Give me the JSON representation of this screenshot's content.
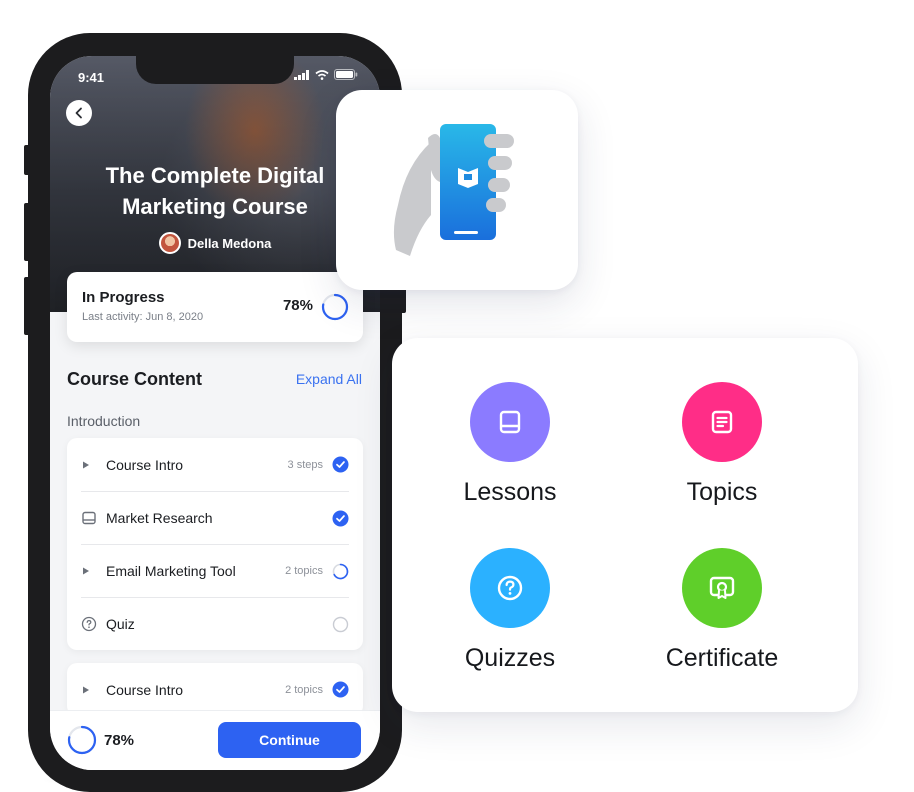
{
  "phone": {
    "status_time": "9:41",
    "course_title_line1": "The Complete Digital",
    "course_title_line2": "Marketing Course",
    "author_name": "Della Medona",
    "progress": {
      "title": "In Progress",
      "last_activity": "Last activity: Jun 8, 2020",
      "percent_label": "78%",
      "percent": 78
    },
    "section_title": "Course Content",
    "expand_all_label": "Expand All",
    "group_label": "Introduction",
    "lessons": [
      {
        "label": "Course Intro",
        "lead_icon": "triangle-right-icon",
        "meta": "3 steps",
        "status": "complete"
      },
      {
        "label": "Market Research",
        "lead_icon": "book-icon",
        "meta": "",
        "status": "complete"
      },
      {
        "label": "Email Marketing Tool",
        "lead_icon": "triangle-right-icon",
        "meta": "2 topics",
        "status": "partial"
      },
      {
        "label": "Quiz",
        "lead_icon": "question-icon",
        "meta": "",
        "status": "empty"
      }
    ],
    "lessons2": [
      {
        "label": "Course Intro",
        "lead_icon": "triangle-right-icon",
        "meta": "2 topics",
        "status": "complete"
      }
    ],
    "bottom": {
      "percent_label": "78%",
      "continue_label": "Continue"
    }
  },
  "features": [
    {
      "label": "Lessons",
      "icon": "book-icon",
      "color": "#8b7bff"
    },
    {
      "label": "Topics",
      "icon": "document-icon",
      "color": "#ff2d87"
    },
    {
      "label": "Quizzes",
      "icon": "question-icon",
      "color": "#2bb1ff"
    },
    {
      "label": "Certificate",
      "icon": "certificate-icon",
      "color": "#5fcf2a"
    }
  ],
  "colors": {
    "accent_blue": "#2d62f2",
    "link_blue": "#3a72f0",
    "app_icon_gradient_top": "#29b8e8",
    "app_icon_gradient_bottom": "#1a6fdc"
  }
}
